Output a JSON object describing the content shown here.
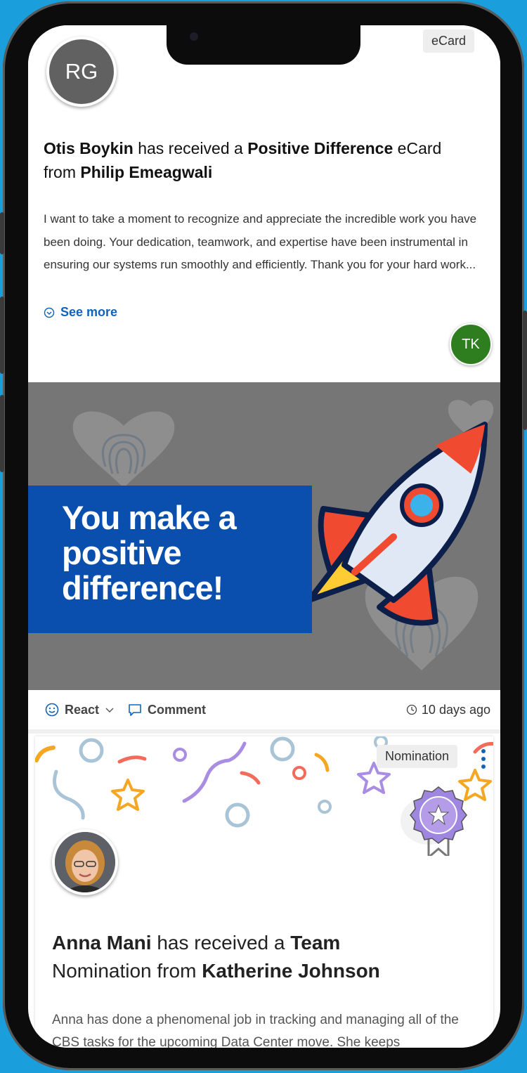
{
  "card1": {
    "tag": "eCard",
    "sender_initials": "RG",
    "recipient": "Otis Boykin",
    "received_text": " has received a ",
    "award": "Positive Difference",
    "award_suffix": " eCard",
    "from_text": "from ",
    "sender": "Philip Emeagwali",
    "message": "I want to take a moment to recognize and appreciate the incredible work you have been doing. Your dedication, teamwork, and expertise have been instrumental in ensuring our systems run smoothly and efficiently. Thank you for your hard work...",
    "see_more": "See more",
    "reactor_initials": "TK",
    "banner_text": "You make a positive difference!",
    "react_label": "React",
    "comment_label": "Comment",
    "time": "10 days ago"
  },
  "card2": {
    "tag": "Nomination",
    "recipient": "Anna Mani",
    "received_text": " has received a ",
    "award": "Team",
    "line2_prefix": "Nomination from ",
    "sender": "Katherine Johnson",
    "message": "Anna has done a phenomenal job in tracking and managing all of the CBS tasks for the upcoming Data Center move. She keeps"
  },
  "colors": {
    "background": "#1a9fdc",
    "link": "#1363b8",
    "banner_blue": "#0a4fae",
    "banner_gray": "#767676",
    "avatar_rg": "#616161",
    "avatar_tk": "#2e7d1f"
  }
}
